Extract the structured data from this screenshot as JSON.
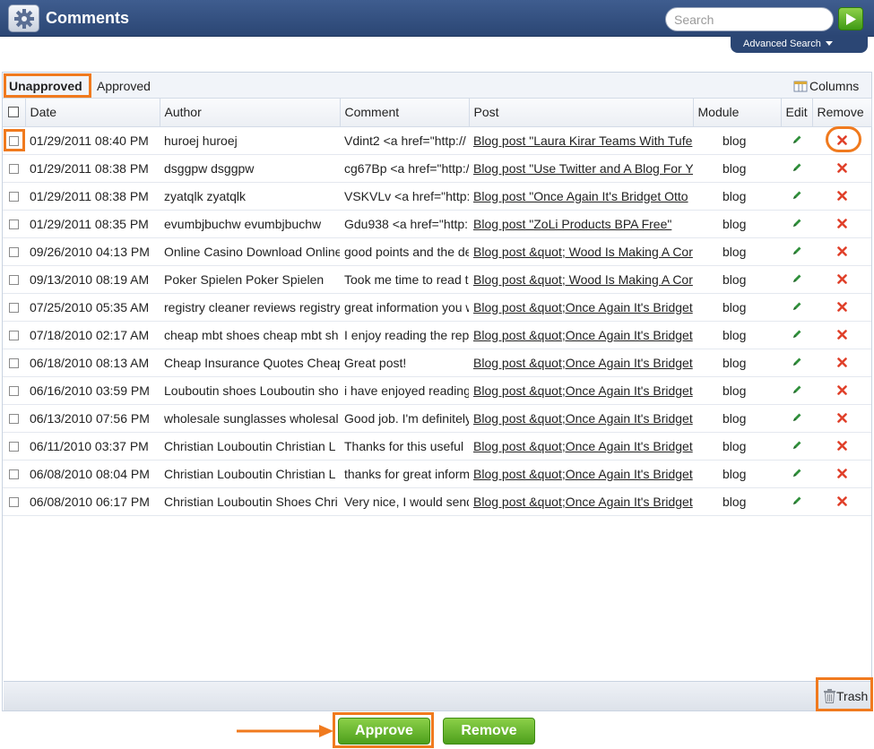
{
  "header": {
    "title": "Comments",
    "search_placeholder": "Search",
    "advanced_search": "Advanced Search"
  },
  "tabs": [
    {
      "label": "Unapproved",
      "active": true
    },
    {
      "label": "Approved",
      "active": false
    }
  ],
  "columns_button": "Columns",
  "table": {
    "headers": {
      "date": "Date",
      "author": "Author",
      "comment": "Comment",
      "post": "Post",
      "module": "Module",
      "edit": "Edit",
      "remove": "Remove"
    },
    "rows": [
      {
        "date": "01/29/2011 08:40 PM",
        "author": "huroej huroej",
        "comment": "Vdint2 <a href=\"http://",
        "post": "Blog post \"Laura Kirar Teams With Tufe",
        "module": "blog"
      },
      {
        "date": "01/29/2011 08:38 PM",
        "author": "dsggpw dsggpw",
        "comment": "cg67Bp <a href=\"http:/",
        "post": "Blog post \"Use Twitter and A Blog For Y",
        "module": "blog"
      },
      {
        "date": "01/29/2011 08:38 PM",
        "author": "zyatqlk zyatqlk",
        "comment": "VSKVLv <a href=\"http:",
        "post": "Blog post \"Once Again It's Bridget Otto",
        "module": "blog"
      },
      {
        "date": "01/29/2011 08:35 PM",
        "author": "evumbjbuchw evumbjbuchw",
        "comment": "Gdu938 <a href=\"http:",
        "post": "Blog post \"ZoLi Products BPA Free\"",
        "module": "blog"
      },
      {
        "date": "09/26/2010 04:13 PM",
        "author": "Online Casino Download Online",
        "comment": "good points and the de",
        "post": "Blog post &quot; Wood Is Making A Cor",
        "module": "blog"
      },
      {
        "date": "09/13/2010 08:19 AM",
        "author": "Poker Spielen Poker Spielen",
        "comment": "Took me time to read t",
        "post": "Blog post &quot; Wood Is Making A Cor",
        "module": "blog"
      },
      {
        "date": "07/25/2010 05:35 AM",
        "author": "registry cleaner reviews registry",
        "comment": "great information you w",
        "post": "Blog post &quot;Once Again It's Bridget",
        "module": "blog"
      },
      {
        "date": "07/18/2010 02:17 AM",
        "author": "cheap mbt shoes cheap mbt sh",
        "comment": "I enjoy reading the rep",
        "post": "Blog post &quot;Once Again It's Bridget",
        "module": "blog"
      },
      {
        "date": "06/18/2010 08:13 AM",
        "author": "Cheap Insurance Quotes Cheap",
        "comment": "Great post!",
        "post": "Blog post &quot;Once Again It's Bridget",
        "module": "blog"
      },
      {
        "date": "06/16/2010 03:59 PM",
        "author": "Louboutin shoes Louboutin sho",
        "comment": "i have enjoyed reading",
        "post": "Blog post &quot;Once Again It's Bridget",
        "module": "blog"
      },
      {
        "date": "06/13/2010 07:56 PM",
        "author": "wholesale sunglasses wholesal",
        "comment": "Good job. I'm definitely",
        "post": "Blog post &quot;Once Again It's Bridget",
        "module": "blog"
      },
      {
        "date": "06/11/2010 03:37 PM",
        "author": "Christian Louboutin Christian L",
        "comment": "Thanks for this useful",
        "post": "Blog post &quot;Once Again It's Bridget",
        "module": "blog"
      },
      {
        "date": "06/08/2010 08:04 PM",
        "author": "Christian Louboutin Christian L",
        "comment": "thanks for great inform",
        "post": "Blog post &quot;Once Again It's Bridget",
        "module": "blog"
      },
      {
        "date": "06/08/2010 06:17 PM",
        "author": "Christian Louboutin Shoes Chri",
        "comment": "Very nice, I would send",
        "post": "Blog post &quot;Once Again It's Bridget",
        "module": "blog"
      }
    ]
  },
  "footer": {
    "trash_label": "Trash"
  },
  "actions": {
    "approve_label": "Approve",
    "remove_label": "Remove"
  },
  "colors": {
    "header_bg": "#2b4674",
    "button_green": "#5aa823",
    "highlight": "#f07a1e",
    "remove_red": "#e0402a",
    "edit_green": "#2f8f3a"
  },
  "icons": {
    "app": "gear-icon",
    "search": "play-arrow-icon",
    "edit": "pencil-icon",
    "remove": "red-x-icon",
    "trash": "trash-icon",
    "columns": "columns-icon"
  }
}
